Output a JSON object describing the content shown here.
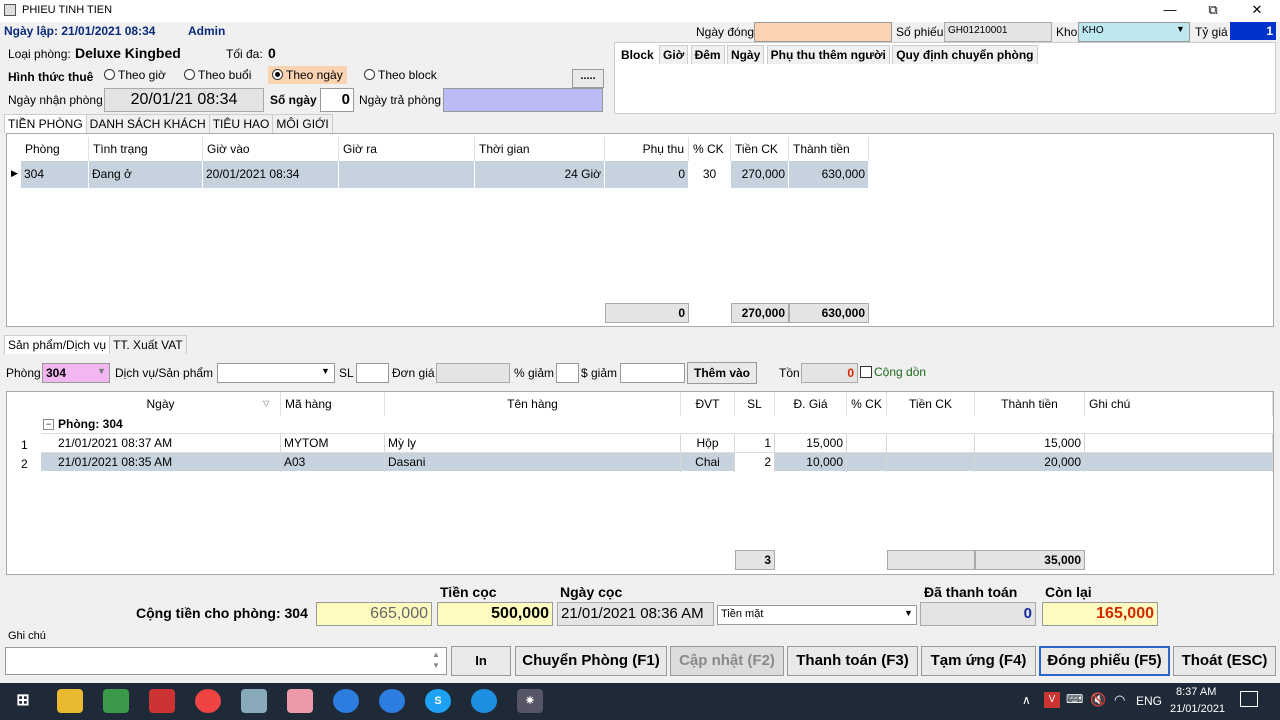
{
  "window": {
    "title": "PHIEU TINH TIEN",
    "min": "—",
    "max": "⧉",
    "close": "✕"
  },
  "header": {
    "ngay_lap": "Ngày lập: 21/01/2021 08:34",
    "user": "Admin",
    "ngay_dong_label": "Ngày đóng",
    "ngay_dong": "",
    "so_phieu_label": "Số phiếu",
    "so_phieu": "GH01210001",
    "kho_label": "Kho",
    "kho": "KHO",
    "ty_gia_label": "Tỷ giá",
    "ty_gia": "1"
  },
  "room": {
    "loai_label": "Loại phòng:",
    "loai": "Deluxe Kingbed",
    "toi_da_label": "Tối đa:",
    "toi_da": "0",
    "hinh_thuc_label": "Hình thức thuê",
    "options": [
      "Theo giờ",
      "Theo buổi",
      "Theo ngày",
      "Theo block"
    ],
    "selected": "Theo ngày",
    "more": ".....",
    "nhan_label": "Ngày nhận phòng",
    "nhan": "20/01/21 08:34",
    "so_ngay_label": "Số ngày",
    "so_ngay": "0",
    "tra_label": "Ngày trả phòng",
    "tra": ""
  },
  "right_tabs": [
    "Block",
    "Giờ",
    "Đêm",
    "Ngày",
    "Phụ thu thêm người",
    "Quy định chuyển phòng"
  ],
  "tabs1": [
    "TIỀN PHÒNG",
    "DANH SÁCH KHÁCH",
    "TIÊU HAO",
    "MÔI GIỚI"
  ],
  "room_grid": {
    "headers": [
      "Phòng",
      "Tình trạng",
      "Giờ vào",
      "Giờ ra",
      "Thời gian",
      "Phụ thu",
      "% CK",
      "Tiền CK",
      "Thành tiền"
    ],
    "row": [
      "304",
      "Đang ở",
      "20/01/2021 08:34",
      "",
      "24 Giờ",
      "0",
      "30",
      "270,000",
      "630,000"
    ],
    "totals": [
      "0",
      "270,000",
      "630,000"
    ]
  },
  "tabs2": [
    "Sản phẩm/Dịch vụ",
    "TT. Xuất VAT"
  ],
  "svc": {
    "phong_label": "Phòng",
    "phong": "304",
    "dv_label": "Dịch vụ/Sản phẩm",
    "dv": "",
    "sl_label": "SL",
    "sl": "",
    "don_gia_label": "Đơn giá",
    "don_gia": "",
    "pct_label": "% giảm",
    "pct": "",
    "usd_label": "$ giảm",
    "usd": "",
    "add": "Thêm vào",
    "ton_label": "Tồn",
    "ton": "0",
    "cong_don": "Cộng dồn"
  },
  "svc_grid": {
    "headers": [
      "Ngày",
      "Mã hàng",
      "Tên hàng",
      "ĐVT",
      "SL",
      "Đ. Giá",
      "% CK",
      "Tiền CK",
      "Thành tiền",
      "Ghi chú"
    ],
    "group": "Phòng: 304",
    "rows": [
      {
        "n": "1",
        "c": [
          "21/01/2021 08:37 AM",
          "MYTOM",
          "Mỳ ly",
          "Hộp",
          "1",
          "15,000",
          "",
          "",
          "15,000",
          ""
        ]
      },
      {
        "n": "2",
        "c": [
          "21/01/2021 08:35 AM",
          "A03",
          "Dasani",
          "Chai",
          "2",
          "10,000",
          "",
          "",
          "20,000",
          ""
        ]
      }
    ],
    "tot_sl": "3",
    "tot_ck": "",
    "tot_tt": "35,000"
  },
  "footer": {
    "cong_label": "Cộng tiền cho phòng: 304",
    "cong": "665,000",
    "coc_label": "Tiền cọc",
    "coc": "500,000",
    "ngay_coc_label": "Ngày cọc",
    "ngay_coc": "21/01/2021 08:36 AM",
    "pttt": "Tiền mặt",
    "da_tt_label": "Đã thanh toán",
    "da_tt": "0",
    "con_lai_label": "Còn lại",
    "con_lai": "165,000",
    "ghi_chu_label": "Ghi chú",
    "ghi_chu": ""
  },
  "buttons": [
    "In",
    "Chuyển Phòng (F1)",
    "Cập nhật (F2)",
    "Thanh toán (F3)",
    "Tạm ứng (F4)",
    "Đóng phiếu (F5)",
    "Thoát (ESC)"
  ],
  "taskbar": {
    "time": "8:37 AM",
    "date": "21/01/2021",
    "lang": "ENG"
  },
  "colors": {
    "header_blue": "#0a2a7a",
    "orange": "#fbd3b0",
    "cyan": "#bde8ee",
    "lavender": "#bcbcf5",
    "yellow": "#fdfbc0",
    "sel_row": "#c6d2de"
  }
}
